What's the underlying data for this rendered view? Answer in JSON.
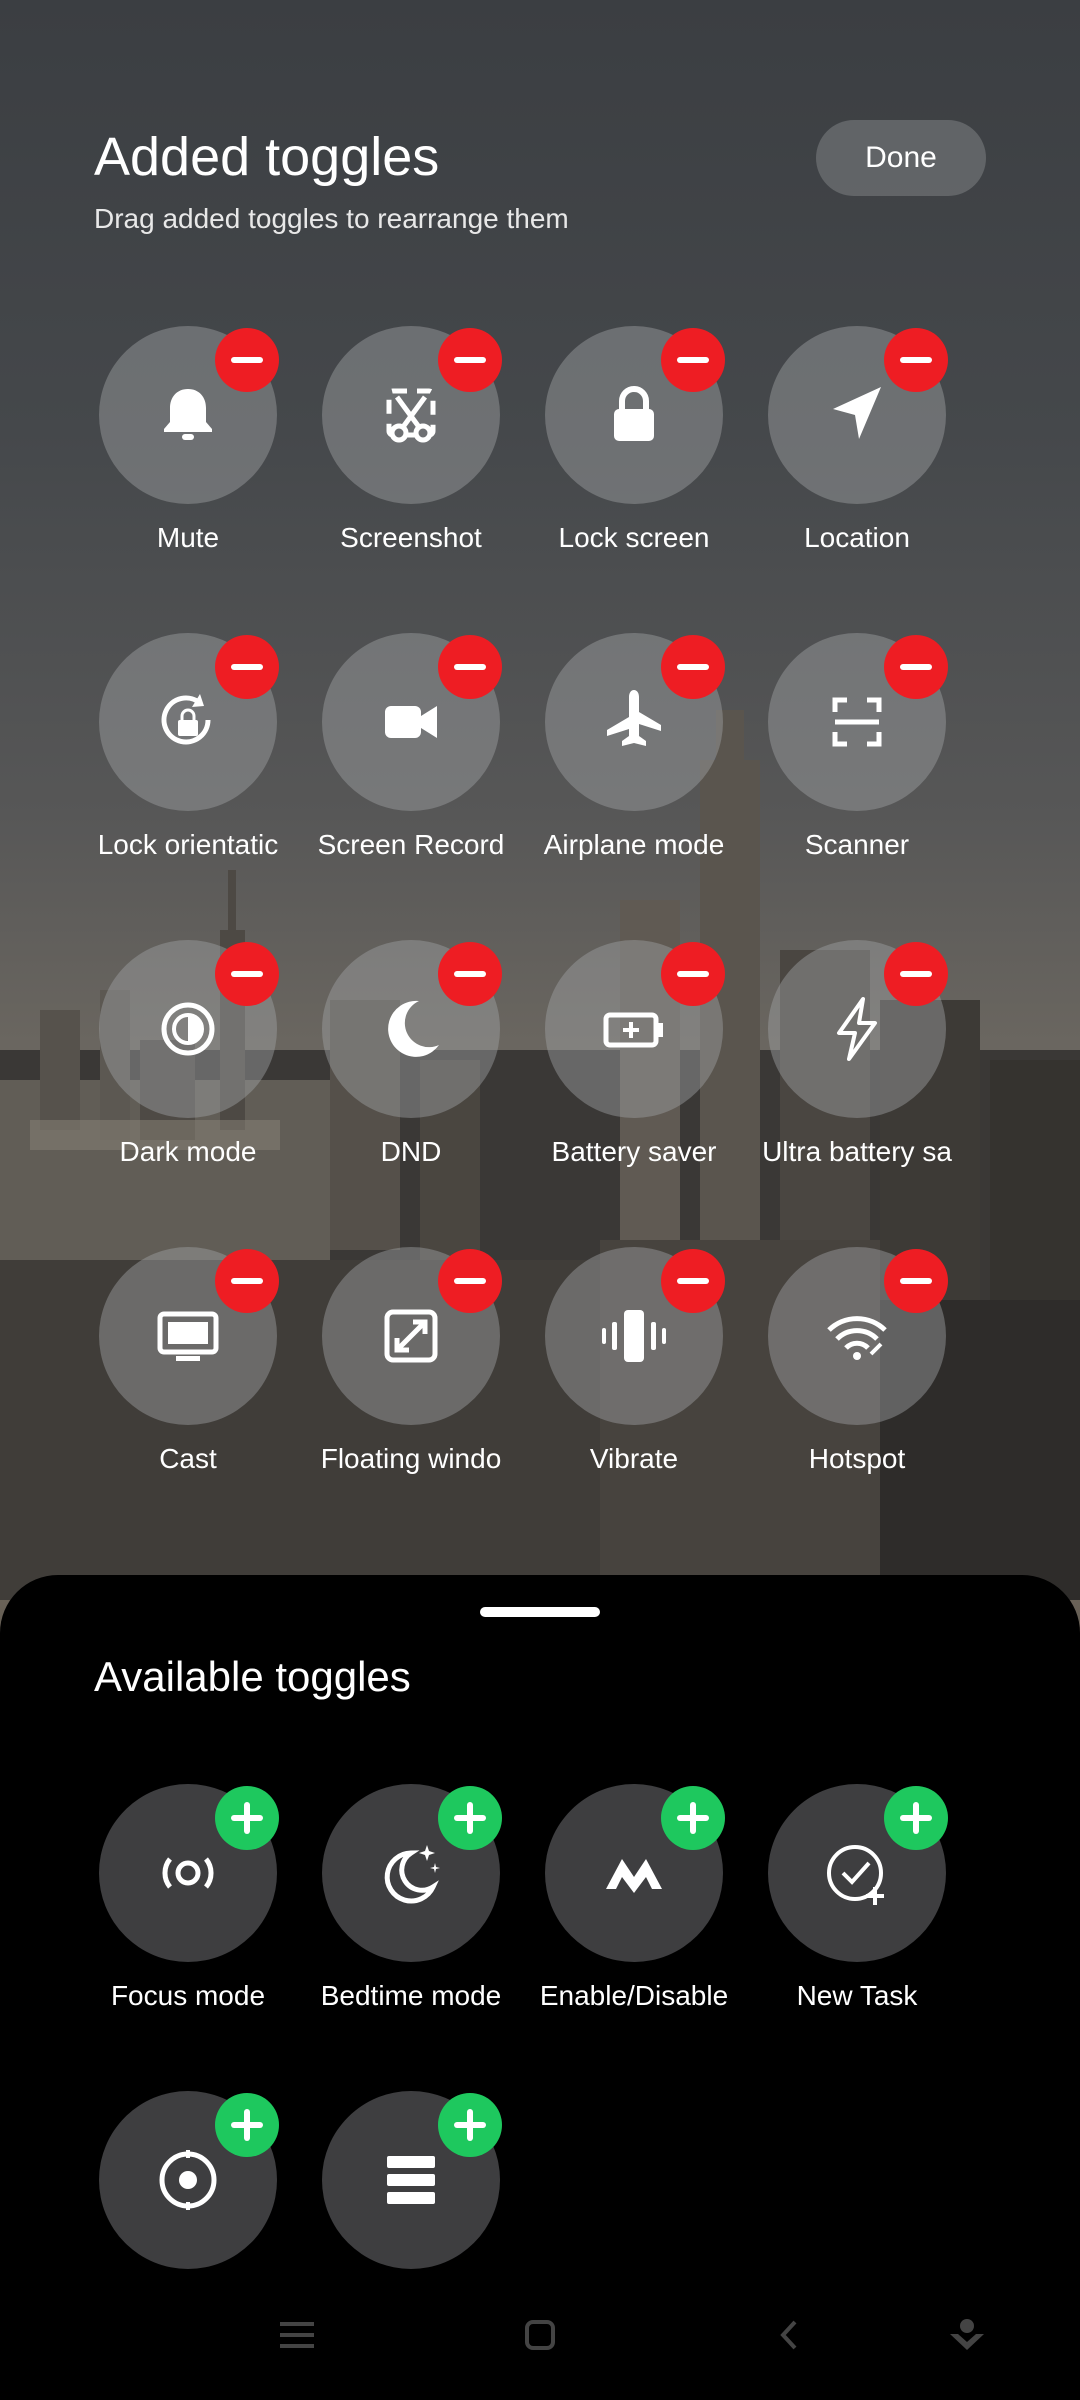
{
  "header": {
    "title": "Added toggles",
    "subtitle": "Drag added toggles to rearrange them",
    "done_label": "Done"
  },
  "added_toggles": [
    {
      "label": "Mute",
      "icon": "bell-icon"
    },
    {
      "label": "Screenshot",
      "icon": "scissors-icon"
    },
    {
      "label": "Lock screen",
      "icon": "lock-icon"
    },
    {
      "label": "Location",
      "icon": "location-arrow-icon"
    },
    {
      "label": "Lock orientatic",
      "icon": "rotation-lock-icon"
    },
    {
      "label": "Screen Record",
      "icon": "video-camera-icon"
    },
    {
      "label": "Airplane mode",
      "icon": "airplane-icon"
    },
    {
      "label": "Scanner",
      "icon": "scan-frame-icon"
    },
    {
      "label": "Dark mode",
      "icon": "contrast-icon"
    },
    {
      "label": "DND",
      "icon": "moon-icon"
    },
    {
      "label": "Battery saver",
      "icon": "battery-plus-icon"
    },
    {
      "label": "Ultra battery sa",
      "icon": "lightning-icon"
    },
    {
      "label": "Cast",
      "icon": "monitor-icon"
    },
    {
      "label": "Floating windo",
      "icon": "floating-window-icon"
    },
    {
      "label": "Vibrate",
      "icon": "vibrate-icon"
    },
    {
      "label": "Hotspot",
      "icon": "hotspot-icon"
    }
  ],
  "available": {
    "title": "Available toggles",
    "toggles": [
      {
        "label": "Focus mode",
        "icon": "focus-icon"
      },
      {
        "label": "Bedtime mode",
        "icon": "bedtime-moon-icon"
      },
      {
        "label": "Enable/Disable",
        "icon": "m-logo-icon"
      },
      {
        "label": "New Task",
        "icon": "new-task-icon"
      },
      {
        "label": "",
        "icon": "target-icon"
      },
      {
        "label": "",
        "icon": "list-icon"
      }
    ]
  },
  "colors": {
    "remove_badge": "#ee1d23",
    "add_badge": "#1ec85e",
    "sheet_bg": "#000000"
  },
  "navbar": {
    "icons": [
      "menu-icon",
      "home-square-icon",
      "back-icon",
      "assist-icon"
    ]
  }
}
